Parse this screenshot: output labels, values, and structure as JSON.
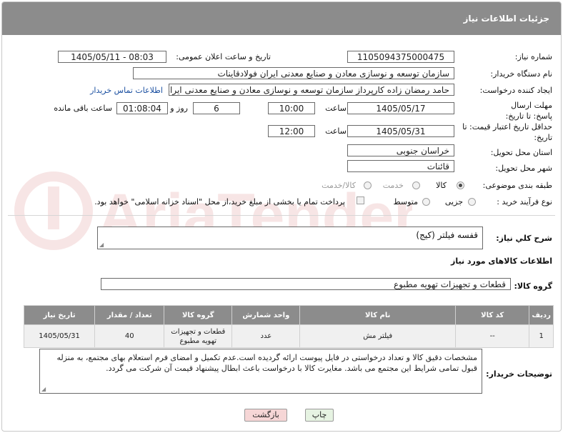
{
  "header": {
    "title": "جزئیات اطلاعات نیاز"
  },
  "form": {
    "need_number": {
      "label": "شماره نیاز:",
      "value": "1105094375000475"
    },
    "announce_datetime": {
      "label": "تاریخ و ساعت اعلان عمومی:",
      "value": "1405/05/11 - 08:03"
    },
    "buyer_org": {
      "label": "نام دستگاه خریدار:",
      "value": "سازمان توسعه و نوسازی معادن و صنایع معدنی ایران فولادقاینات"
    },
    "requester": {
      "label": "ایجاد کننده درخواست:",
      "value": "حامد  رمضان زاده  کارپرداز  سازمان توسعه و نوسازی معادن و صنایع معدنی ایران",
      "contact_link": "اطلاعات تماس خریدار"
    },
    "response_deadline": {
      "label": "مهلت ارسال پاسخ: تا تاریخ:",
      "date": "1405/05/17",
      "time_label": "ساعت",
      "time": "10:00",
      "days": "6",
      "days_label": "روز و",
      "remaining": "01:08:04",
      "remaining_label": "ساعت باقی مانده"
    },
    "price_validity": {
      "label": "حداقل تاریخ اعتبار قیمت: تا تاریخ:",
      "date": "1405/05/31",
      "time_label": "ساعت",
      "time": "12:00"
    },
    "delivery_province": {
      "label": "استان محل تحویل:",
      "value": "خراسان جنوبی"
    },
    "delivery_city": {
      "label": "شهر محل تحویل:",
      "value": "قائنات"
    },
    "category": {
      "label": "طبقه بندی موضوعی:",
      "options": [
        "کالا",
        "خدمت",
        "کالا/خدمت"
      ],
      "selected": "کالا"
    },
    "process_type": {
      "label": "نوع فرآیند خرید :",
      "options": [
        "جزیی",
        "متوسط"
      ],
      "payment_note": "پرداخت تمام یا بخشی از مبلغ خرید،از محل \"اسناد خزانه اسلامی\" خواهد بود."
    }
  },
  "need_description": {
    "label": "شرح کلي نیاز:",
    "value": "قفسه فیلتر (کیج)"
  },
  "goods_info": {
    "label": "اطلاعات کالاهای مورد نیاز"
  },
  "goods_group": {
    "label": "گروه کالا:",
    "value": "قطعات و تجهیزات تهویه مطبوع"
  },
  "table": {
    "headers": [
      "ردیف",
      "کد کالا",
      "نام کالا",
      "واحد شمارش",
      "گروه کالا",
      "تعداد / مقدار",
      "تاریخ نیاز"
    ],
    "rows": [
      [
        "1",
        "--",
        "فیلتر مش",
        "عدد",
        "قطعات و تجهیزات تهویه مطبوع",
        "40",
        "1405/05/31"
      ]
    ]
  },
  "buyer_notes": {
    "label": "توضیحات خریدار:",
    "value": "مشخصات دقیق کالا و تعداد درخواستی در فایل پیوست ارائه گردیده است.عدم تکمیل و امضای فرم استعلام بهای مجتمع، به منزله قبول تمامی شرایط این مجتمع می باشد. مغایرت کالا با درخواست باعث ابطال پیشنهاد قیمت آن شرکت می گردد."
  },
  "buttons": {
    "print": "چاپ",
    "back": "بازگشت"
  },
  "watermark": {
    "text": "AriaTender.neT"
  },
  "colors": {
    "header_bg": "#8c8c8c",
    "link": "#1a4fa0",
    "back_button_bg": "#f6d6d6",
    "print_button_bg": "#e6f3e2"
  }
}
